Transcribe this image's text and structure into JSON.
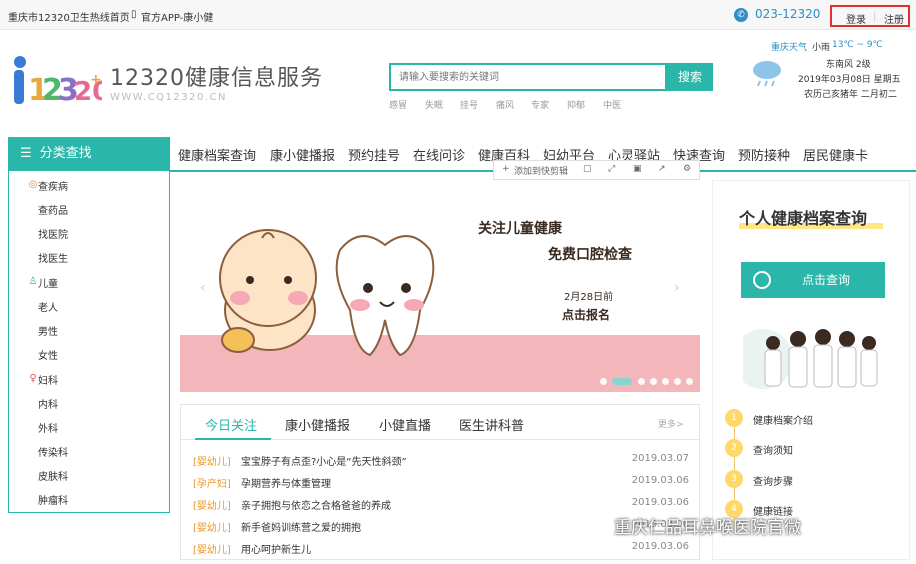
{
  "topbar": {
    "home_link": "重庆市12320卫生热线首页",
    "app_link": "官方APP-康小健",
    "phone": "023-12320",
    "login": "登录",
    "register": "注册"
  },
  "header": {
    "site_title": "12320健康信息服务",
    "site_url": "WWW.CQ12320.CN",
    "search_placeholder": "请输入要搜索的关键词",
    "search_button": "搜索",
    "hot_words": [
      "感冒",
      "失眠",
      "挂号",
      "痛风",
      "专家",
      "抑郁",
      "中医"
    ]
  },
  "weather": {
    "city": "重庆天气",
    "condition": "小雨",
    "temp": "13℃ ~ 9℃",
    "wind": "东南风 2级",
    "date": "2019年03月08日 星期五",
    "lunar": "农历己亥猪年 二月初二"
  },
  "category": {
    "title": "分类查找",
    "groups": [
      {
        "icon": "pill-icon",
        "items": [
          "查疾病",
          "查药品",
          "找医院",
          "找医生"
        ]
      },
      {
        "icon": "person-icon",
        "items": [
          "儿童",
          "老人",
          "男性",
          "女性"
        ]
      },
      {
        "icon": "female-icon",
        "items": [
          "妇科",
          "内科",
          "外科",
          "传染科",
          "皮肤科",
          "肿瘤科"
        ]
      }
    ]
  },
  "nav": [
    "健康档案查询",
    "康小健播报",
    "预约挂号",
    "在线问诊",
    "健康百科",
    "妇幼平台",
    "心灵驿站",
    "快速查询",
    "预防接种",
    "居民健康卡"
  ],
  "quickbar": {
    "add_label": "添加到快剪辑"
  },
  "banner": {
    "line1": "关注儿童健康",
    "line2": "免费口腔检查",
    "date": "2月28日前",
    "cta": "点击报名"
  },
  "news": {
    "tabs": [
      "今日关注",
      "康小健播报",
      "小健直播",
      "医生讲科普"
    ],
    "more": "更多>",
    "items": [
      {
        "tag": "[婴幼儿]",
        "title": "宝宝脖子有点歪?小心是“先天性斜颈”",
        "date": "2019.03.07"
      },
      {
        "tag": "[孕产妇]",
        "title": "孕期营养与体重管理",
        "date": "2019.03.06"
      },
      {
        "tag": "[婴幼儿]",
        "title": "亲子拥抱与依恋之合格爸爸的养成",
        "date": "2019.03.06"
      },
      {
        "tag": "[婴幼儿]",
        "title": "新手爸妈训练营之爱的拥抱",
        "date": "2019.03.06"
      },
      {
        "tag": "[婴幼儿]",
        "title": "用心呵护新生儿",
        "date": "2019.03.06"
      }
    ]
  },
  "side": {
    "title": "个人健康档案查询",
    "query_button": "点击查询",
    "steps": [
      "健康档案介绍",
      "查询须知",
      "查询步骤",
      "健康链接"
    ]
  },
  "watermark": "重庆仁品耳鼻喉医院官微"
}
